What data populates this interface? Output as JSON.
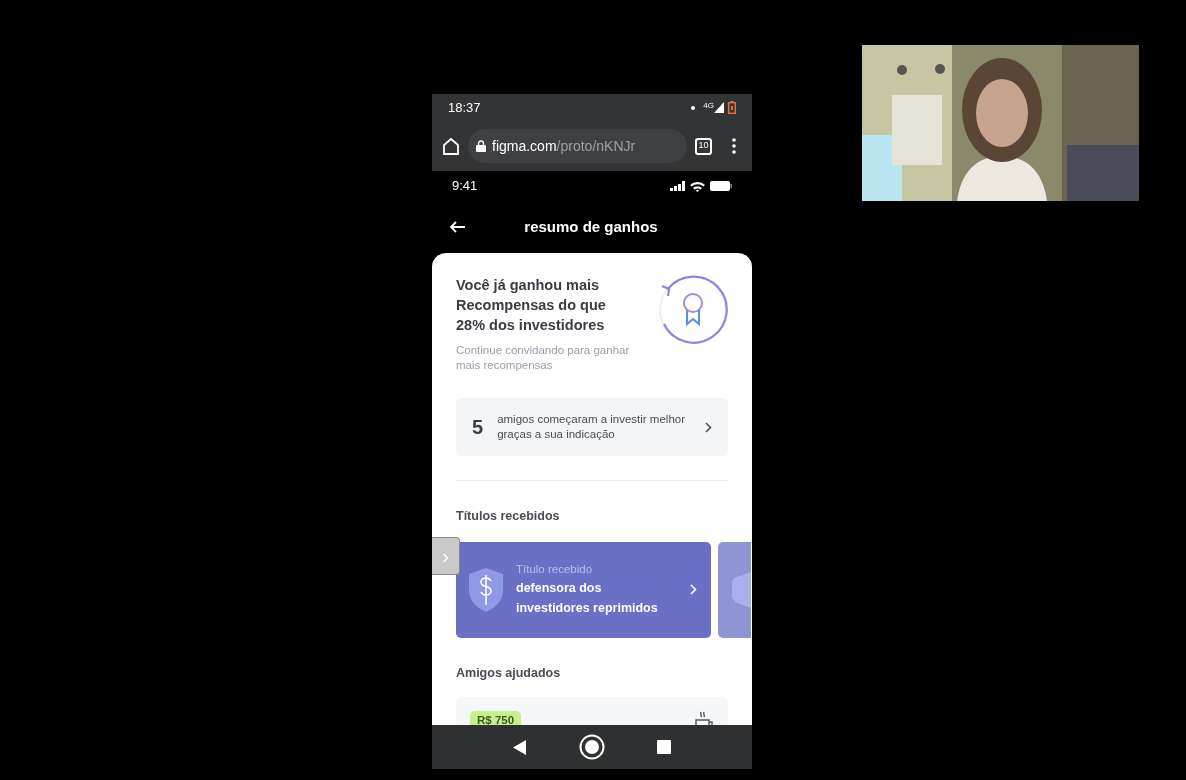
{
  "device_status": {
    "time": "18:37",
    "network": "4G"
  },
  "browser": {
    "url_host": "figma.com",
    "url_path": "/proto/nKNJr",
    "tab_count": "10"
  },
  "app_status": {
    "time": "9:41"
  },
  "header": {
    "title": "resumo de ganhos"
  },
  "summary": {
    "headline": "Você já ganhou mais Recompensas do que 28% dos investidores",
    "subtitle": "Continue convidando para ganhar mais recompensas"
  },
  "referrals": {
    "count": "5",
    "text": "amigos começaram a investir melhor graças a sua indicação"
  },
  "prototype_nav": {
    "glyph": "›"
  },
  "titles_section": {
    "heading": "Títulos recebidos",
    "cards": [
      {
        "kind": "full",
        "label": "Título recebido",
        "name": "defensora dos investidores reprimidos"
      },
      {
        "kind": "partial"
      }
    ]
  },
  "friends_section": {
    "heading": "Amigos ajudados",
    "items": [
      {
        "amount": "R$ 750"
      }
    ]
  }
}
